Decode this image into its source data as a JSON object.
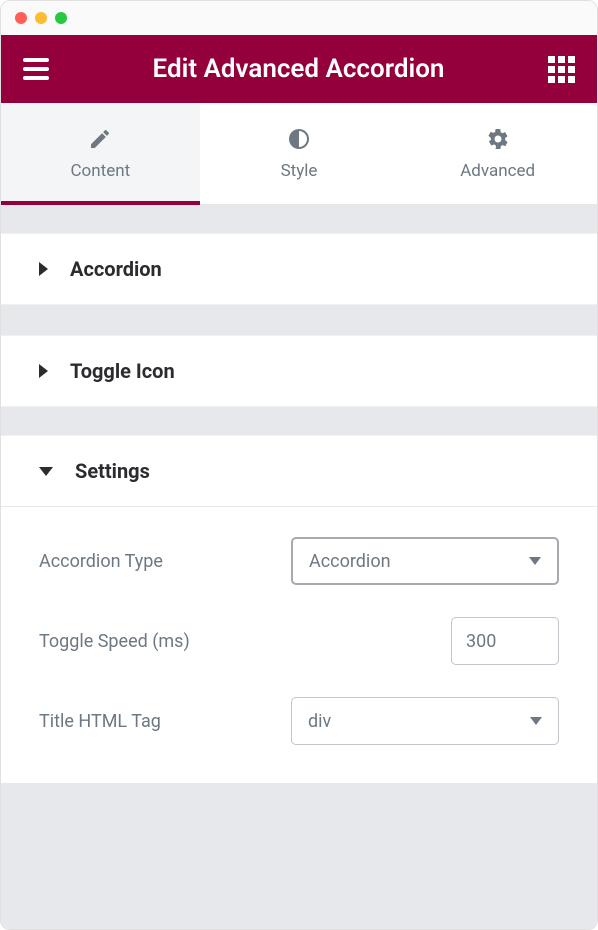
{
  "header": {
    "title": "Edit Advanced Accordion"
  },
  "tabs": {
    "content": "Content",
    "style": "Style",
    "advanced": "Advanced"
  },
  "sections": {
    "accordion": "Accordion",
    "toggleIcon": "Toggle Icon",
    "settings": "Settings"
  },
  "fields": {
    "accordionType": {
      "label": "Accordion Type",
      "value": "Accordion"
    },
    "toggleSpeed": {
      "label": "Toggle Speed (ms)",
      "value": "300"
    },
    "titleHtmlTag": {
      "label": "Title HTML Tag",
      "value": "div"
    }
  }
}
